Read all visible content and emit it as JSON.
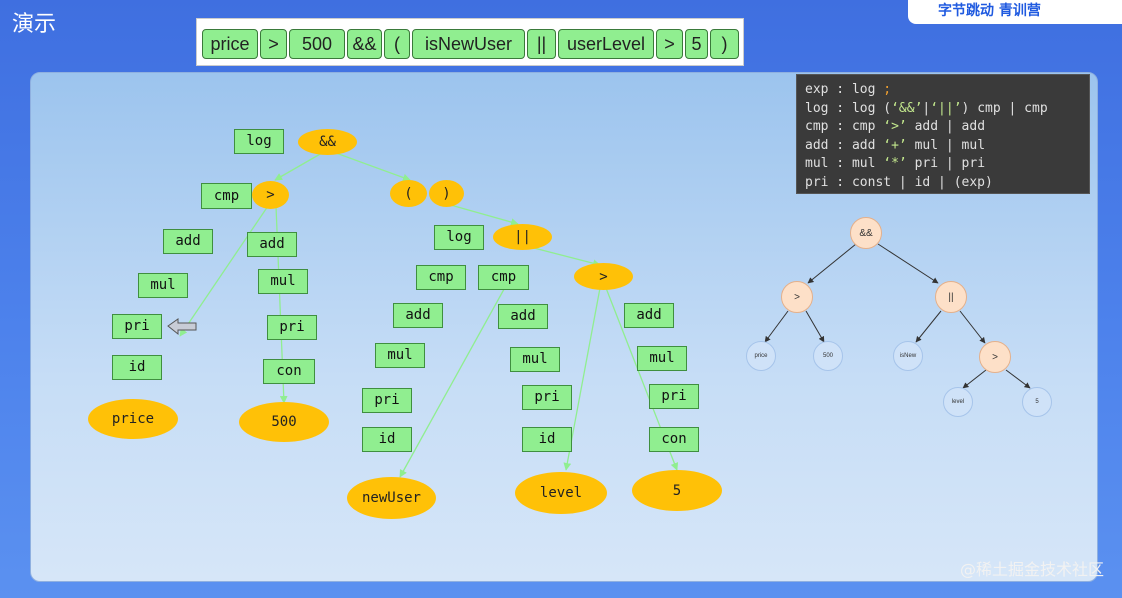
{
  "slide": {
    "title": "演示"
  },
  "branding": {
    "logo_text": "字节跳动  青训营"
  },
  "tokens": [
    "price",
    ">",
    "500",
    "&&",
    "(",
    "isNewUser",
    "||",
    "userLevel",
    ">",
    "5",
    ")"
  ],
  "tree": {
    "nodes": {
      "log1": "log",
      "and1": "&&",
      "cmp1": "cmp",
      "gt1": ">",
      "lp": "(",
      "rp": ")",
      "add1": "add",
      "add2": "add",
      "mul1": "mul",
      "mul2": "mul",
      "pri1": "pri",
      "pri2": "pri",
      "id1": "id",
      "con1": "con",
      "price": "price",
      "n500": "500",
      "log2": "log",
      "or1": "||",
      "cmp2": "cmp",
      "cmp3": "cmp",
      "gt2": ">",
      "add3": "add",
      "add4": "add",
      "add5": "add",
      "mul3": "mul",
      "mul4": "mul",
      "mul5": "mul",
      "pri3": "pri",
      "pri4": "pri",
      "pri5": "pri",
      "id2": "id",
      "id3": "id",
      "con2": "con",
      "newUser": "newUser",
      "level": "level",
      "n5": "5"
    }
  },
  "grammar": {
    "lines": [
      [
        "exp : log ",
        ";"
      ],
      [
        "log : log (",
        "‘&&’",
        "|",
        "‘||’",
        ") cmp | cmp"
      ],
      [
        "cmp : cmp ",
        "‘>’",
        " add | add"
      ],
      [
        "add : add ",
        "‘+’",
        " mul | mul"
      ],
      [
        "mul : mul ",
        "‘*’",
        " pri | pri"
      ],
      [
        "pri : const | id | (exp)"
      ]
    ]
  },
  "compact_tree": {
    "root": "&&",
    "gt": ">",
    "or": "||",
    "price": "price",
    "n500": "500",
    "isNew": "isNew",
    "gt2": ">",
    "level": "level",
    "five": "5"
  },
  "watermark": "@稀土掘金技术社区",
  "colors": {
    "token_fill": "#90ee90",
    "op_node": "#ffc107",
    "edge": "#90ee90",
    "background": "#4d82ec",
    "arrow": "#e02020"
  }
}
